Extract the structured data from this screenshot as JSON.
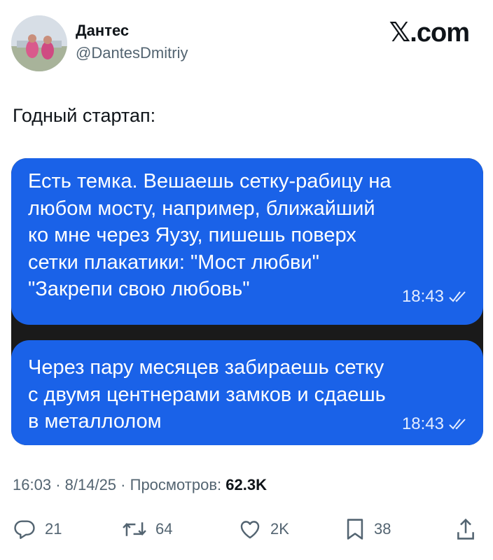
{
  "author": {
    "display_name": "Дантес",
    "handle": "@DantesDmitriy"
  },
  "site": {
    "logo_glyph": "𝕏",
    "logo_text": ".com"
  },
  "tweet": {
    "text": "Годный стартап:"
  },
  "chat": {
    "bubbles": [
      {
        "lines": [
          "Есть темка. Вешаешь сетку-рабицу на",
          "любом мосту, например, ближайший",
          "ко мне через Яузу, пишешь поверх",
          "сетки плакатики: \"Мост любви\"",
          "\"Закрепи свою любовь\""
        ],
        "time": "18:43",
        "status_icon": "double-check-icon"
      },
      {
        "lines": [
          "Через пару месяцев забираешь сетку",
          "с двумя центнерами замков и сдаешь",
          "в металлолом"
        ],
        "time": "18:43",
        "status_icon": "double-check-icon"
      }
    ],
    "bubble_color": "#1a62e8",
    "background_color": "#1a1a1a"
  },
  "meta": {
    "time": "16:03",
    "separator": "·",
    "date": "8/14/25",
    "views_label": "Просмотров:",
    "views_count": "62.3K"
  },
  "actions": {
    "reply": {
      "icon": "reply-icon",
      "count": "21"
    },
    "repost": {
      "icon": "repost-icon",
      "count": "64"
    },
    "like": {
      "icon": "heart-icon",
      "count": "2K"
    },
    "bookmark": {
      "icon": "bookmark-icon",
      "count": "38"
    },
    "share": {
      "icon": "share-icon"
    }
  },
  "colors": {
    "text_primary": "#0f1419",
    "text_secondary": "#536471"
  }
}
